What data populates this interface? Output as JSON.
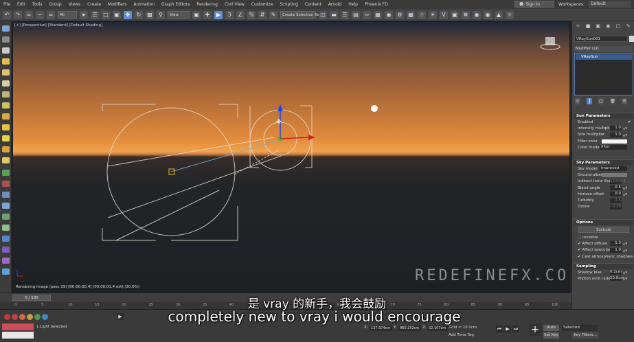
{
  "menu": {
    "items": [
      "File",
      "Edit",
      "Tools",
      "Group",
      "Views",
      "Create",
      "Modifiers",
      "Animation",
      "Graph Editors",
      "Rendering",
      "Civil View",
      "Customize",
      "Scripting",
      "Content",
      "Arnold",
      "Help",
      "Phoenix FD"
    ],
    "sign_in": "Sign In",
    "workspaces_label": "Workspaces:",
    "workspace_value": "Default"
  },
  "toolbar": {
    "filter_value": "All",
    "view_value": "View",
    "selection_set_placeholder": "Create Selection Se"
  },
  "viewport": {
    "label": "[+] [Perspective] [Standard] [Default Shading]",
    "status": "Rendering image (pass 19) [00:00:00.4] [00:00:01.4 est]   (30.0%)",
    "watermark": "REDEFINEFX.COM"
  },
  "command_panel": {
    "object_name": "VRaySun001",
    "modifier_list": "Modifier List",
    "stack_item": "VRaySun",
    "sun": {
      "header": "Sun Parameters",
      "enabled_label": "Enabled",
      "intensity_label": "Intensity multiplier",
      "intensity_value": "1.0",
      "size_label": "Size multiplier",
      "size_value": "1.0",
      "filter_label": "Filter color",
      "colormode_label": "Color mode",
      "colormode_value": "filter"
    },
    "sky": {
      "header": "Sky Parameters",
      "model_label": "Sky model",
      "model_value": "Improved",
      "albedo_label": "Ground albedo",
      "horiz_label": "Indirect horiz illum",
      "horiz_value": "25000.0",
      "blend_label": "Blend angle",
      "blend_value": "0.5",
      "offset_label": "Horizon offset",
      "offset_value": "0.0",
      "turbidity_label": "Turbidity",
      "turbidity_value": "2.5",
      "ozone_label": "Ozone",
      "ozone_value": "0.35"
    },
    "options": {
      "header": "Options",
      "exclude_button": "Exclude",
      "invisible_label": "Invisible",
      "affect_diffuse_label": "Affect diffuse",
      "affect_diffuse_value": "1.0",
      "affect_specular_label": "Affect specular",
      "affect_specular_value": "1.0",
      "cast_shadows_label": "Cast atmospheric shadows"
    },
    "sampling": {
      "header": "Sampling",
      "bias_label": "Shadow bias",
      "bias_value": "0.2cm",
      "photon_label": "Photon emit radius",
      "photon_value": "50.0cm"
    }
  },
  "timeline": {
    "frame_slider": "0 / 100",
    "ruler_ticks": [
      "0",
      "5",
      "10",
      "15",
      "20",
      "25",
      "30",
      "35",
      "40",
      "45",
      "50",
      "55",
      "60",
      "65",
      "70",
      "75",
      "80",
      "85",
      "90",
      "95",
      "100"
    ]
  },
  "status": {
    "selection_text": "1 Light Selected",
    "x_label": "X:",
    "x_value": "137.674cm",
    "y_label": "Y:",
    "y_value": "980.252cm",
    "z_label": "Z:",
    "z_value": "32.107cm",
    "grid": "Grid = 10.0cm",
    "add_time_tag": "Add Time Tag",
    "auto_key": "Auto Key",
    "selected_dropdown": "Selected",
    "set_key": "Set Key",
    "key_filters": "Key Filters..."
  },
  "subtitles": {
    "chinese": "是 vray 的新手，我会鼓励",
    "english": "completely new to vray i would encourage"
  },
  "colors": {
    "accent": "#5b8fd6",
    "sun_disk": "#ffffff",
    "gizmo_z": "#2040ff",
    "gizmo_x": "#d02020",
    "gizmo_y": "#20c020",
    "target_box": "#e2c020"
  },
  "icons": {
    "undo": "undo-icon",
    "redo": "redo-icon",
    "link": "link-icon",
    "select": "select-arrow-icon",
    "move": "move-icon",
    "rotate": "rotate-icon",
    "scale": "scale-icon",
    "snap": "snap-3-icon",
    "angle_snap": "angle-snap-icon",
    "percent_snap": "percent-snap-icon",
    "play": "play-icon",
    "create_tab": "plus-icon",
    "modify_tab": "modify-icon"
  }
}
